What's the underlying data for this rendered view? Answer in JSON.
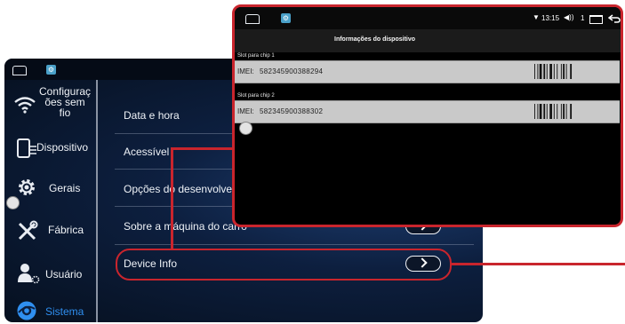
{
  "settings_screen": {
    "sidebar": {
      "items": [
        {
          "label": "Configurações sem fio",
          "lines": [
            "Configuraç",
            "ões sem",
            "fio"
          ],
          "icon": "wifi-icon",
          "active": false
        },
        {
          "label": "Dispositivo",
          "icon": "device-icon",
          "active": false
        },
        {
          "label": "Gerais",
          "icon": "gear-icon",
          "active": false
        },
        {
          "label": "Fábrica",
          "icon": "tools-icon",
          "active": false
        },
        {
          "label": "Usuário",
          "icon": "user-icon",
          "active": false
        },
        {
          "label": "Sistema",
          "icon": "system-icon",
          "active": true
        }
      ]
    },
    "menu": {
      "items": [
        {
          "label": "Data e hora"
        },
        {
          "label": "Acessível"
        },
        {
          "label": "Opções do desenvolvedor"
        },
        {
          "label": "Sobre a máquina do carro"
        },
        {
          "label": "Device Info"
        }
      ]
    },
    "colors": {
      "active": "#2f8ff0",
      "callout": "#c9252d"
    }
  },
  "device_info_screen": {
    "title": "Informações do dispositivo",
    "status": {
      "time": "13:15",
      "volume_value": "1"
    },
    "slots": [
      {
        "label": "Slot para chip 1",
        "imei_key": "IMEI:",
        "imei": "582345900388294"
      },
      {
        "label": "Slot para chip 2",
        "imei_key": "IMEI:",
        "imei": "582345900388302"
      }
    ]
  }
}
